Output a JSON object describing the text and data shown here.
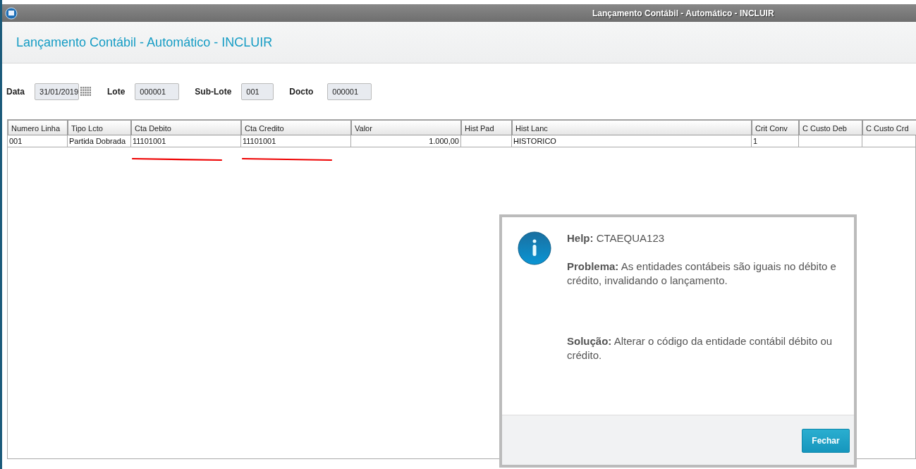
{
  "window": {
    "title": "Lançamento Contábil - Automático - INCLUIR"
  },
  "header": {
    "title": "Lançamento Contábil - Automático - INCLUIR"
  },
  "fields": [
    {
      "label": "Data",
      "value": "31/01/2019",
      "calendar": true
    },
    {
      "label": "Lote",
      "value": "000001",
      "calendar": false
    },
    {
      "label": "Sub-Lote",
      "value": "001",
      "calendar": false
    },
    {
      "label": "Docto",
      "value": "000001",
      "calendar": false
    }
  ],
  "table": {
    "columns": [
      {
        "label": "Numero Linha"
      },
      {
        "label": "Tipo Lcto"
      },
      {
        "label": "Cta Debito",
        "underlined": true
      },
      {
        "label": "Cta Credito",
        "underlined": true
      },
      {
        "label": "Valor",
        "numeric": true
      },
      {
        "label": "Hist Pad"
      },
      {
        "label": "Hist Lanc"
      },
      {
        "label": "Crit Conv"
      },
      {
        "label": "C Custo Deb"
      },
      {
        "label": "C Custo Crd"
      }
    ],
    "rows": [
      [
        "001",
        "Partida Dobrada",
        "11101001",
        "11101001",
        "1.000,00",
        "",
        "HISTORICO",
        "1",
        "",
        ""
      ]
    ]
  },
  "dialog": {
    "paragraphs": [
      "**Help:** CTAEQUA123",
      "**Problema:** As entidades contábeis são iguais no débito e crédito, invalidando o lançamento.",
      "**Solução:** Alterar o código da entidade contábil débito ou crédito."
    ],
    "button": "Fechar"
  }
}
